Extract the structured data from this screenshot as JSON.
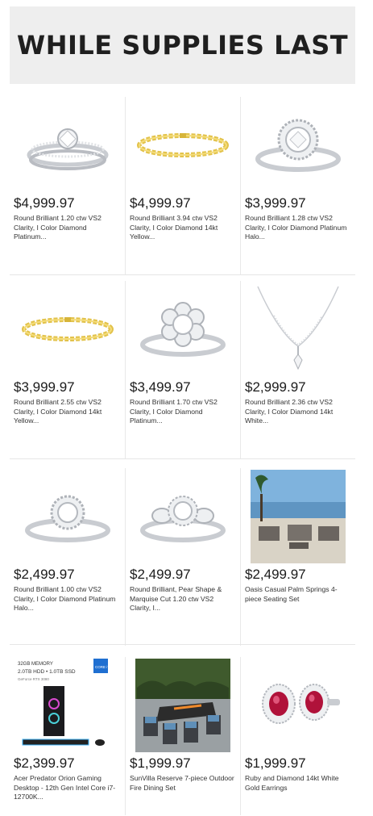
{
  "banner": {
    "title": "WHILE SUPPLIES LAST"
  },
  "products": [
    {
      "price": "$4,999.97",
      "description": "Round Brilliant 1.20 ctw VS2 Clarity, I Color Diamond Platinum...",
      "image": "diamond-bridal-ring-set-icon"
    },
    {
      "price": "$4,999.97",
      "description": "Round Brilliant 3.94 ctw VS2 Clarity, I Color Diamond 14kt Yellow...",
      "image": "gold-link-bracelet-icon"
    },
    {
      "price": "$3,999.97",
      "description": "Round Brilliant 1.28 ctw VS2 Clarity, I Color Diamond Platinum Halo...",
      "image": "halo-diamond-ring-icon"
    },
    {
      "price": "$3,999.97",
      "description": "Round Brilliant 2.55 ctw VS2 Clarity, I Color Diamond 14kt Yellow...",
      "image": "gold-link-bracelet-icon"
    },
    {
      "price": "$3,499.97",
      "description": "Round Brilliant 1.70 ctw VS2 Clarity, I Color Diamond Platinum...",
      "image": "flower-diamond-ring-icon"
    },
    {
      "price": "$2,999.97",
      "description": "Round Brilliant 2.36 ctw VS2 Clarity, I Color Diamond 14kt White...",
      "image": "diamond-necklace-icon"
    },
    {
      "price": "$2,499.97",
      "description": "Round Brilliant 1.00 ctw VS2 Clarity, I Color Diamond Platinum Halo...",
      "image": "halo-diamond-ring-icon"
    },
    {
      "price": "$2,499.97",
      "description": "Round Brilliant, Pear Shape & Marquise Cut 1.20 ctw VS2 Clarity, I...",
      "image": "three-stone-diamond-ring-icon"
    },
    {
      "price": "$2,499.97",
      "description": "Oasis Casual Palm Springs 4-piece Seating Set",
      "image": "patio-seating-set-icon"
    },
    {
      "price": "$2,399.97",
      "description": "Acer Predator Orion Gaming Desktop - 12th Gen Intel Core i7-12700K...",
      "image": "gaming-desktop-icon",
      "image_text": {
        "memory": "32GB MEMORY",
        "storage": "2.0TB HDD • 1.0TB SSD",
        "gpu": "GeForce RTX 3080",
        "badge": "CORE i7"
      }
    },
    {
      "price": "$1,999.97",
      "description": "SunVilla Reserve 7-piece Outdoor Fire Dining Set",
      "image": "outdoor-fire-dining-set-icon"
    },
    {
      "price": "$1,999.97",
      "description": "Ruby and Diamond 14kt White Gold Earrings",
      "image": "ruby-diamond-earrings-icon"
    }
  ],
  "colors": {
    "banner_bg": "#eeeeee",
    "gold": "#e2c24a",
    "platinum": "#c9ccd1",
    "ruby": "#b0123a"
  }
}
